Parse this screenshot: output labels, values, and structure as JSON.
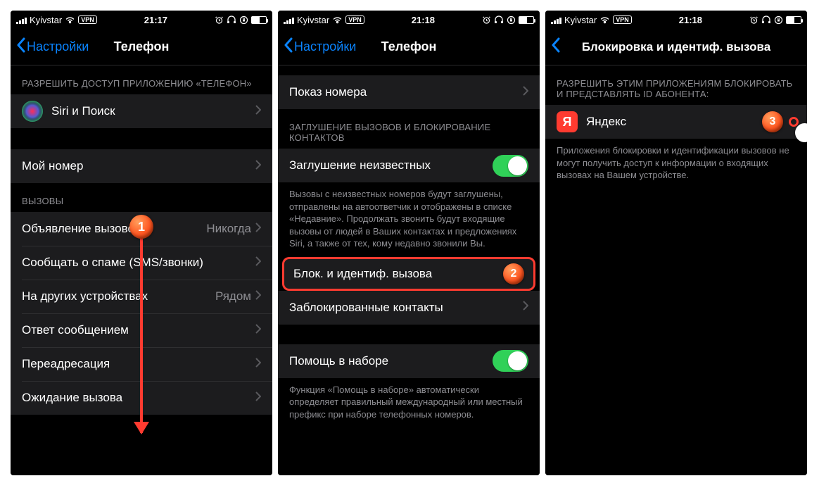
{
  "statusbar": {
    "carrier": "Kyivstar",
    "vpn_badge": "VPN"
  },
  "screen1": {
    "time": "21:17",
    "back": "Настройки",
    "title": "Телефон",
    "sections": {
      "allow_header": "РАЗРЕШИТЬ ДОСТУП ПРИЛОЖЕНИЮ «ТЕЛЕФОН»",
      "siri_label": "Siri и Поиск",
      "my_number": "Мой номер",
      "calls_header": "ВЫЗОВЫ",
      "announce": {
        "label": "Объявление вызовов",
        "value": "Никогда"
      },
      "spam": "Сообщать о спаме (SMS/звонки)",
      "other_devices": {
        "label": "На других устройствах",
        "value": "Рядом"
      },
      "respond": "Ответ сообщением",
      "forwarding": "Переадресация",
      "waiting": "Ожидание вызова"
    },
    "marker": "1"
  },
  "screen2": {
    "time": "21:18",
    "back": "Настройки",
    "title": "Телефон",
    "rows": {
      "show_number": "Показ номера",
      "silence_header": "ЗАГЛУШЕНИЕ ВЫЗОВОВ И БЛОКИРОВАНИЕ КОНТАКТОВ",
      "silence_unknown": "Заглушение неизвестных",
      "silence_footer": "Вызовы с неизвестных номеров будут заглушены, отправлены на автоответчик и отображены в списке «Недавние». Продолжать звонить будут входящие вызовы от людей в Ваших контактах и предложениях Siri, а также от тех, кому недавно звонили Вы.",
      "block_id": "Блок. и идентиф. вызова",
      "blocked_contacts": "Заблокированные контакты",
      "dial_assist": "Помощь в наборе",
      "dial_assist_footer": "Функция «Помощь в наборе» автоматически определяет правильный международный или местный префикс при наборе телефонных номеров."
    },
    "marker": "2"
  },
  "screen3": {
    "time": "21:18",
    "title": "Блокировка и идентиф. вызова",
    "header": "РАЗРЕШИТЬ ЭТИМ ПРИЛОЖЕНИЯМ БЛОКИРОВАТЬ И ПРЕДСТАВЛЯТЬ ID АБОНЕНТА:",
    "app": {
      "icon_letter": "Я",
      "name": "Яндекс"
    },
    "footer": "Приложения блокировки и идентификации вызовов не могут получить доступ к информации о входящих вызовах на Вашем устройстве.",
    "marker": "3"
  }
}
